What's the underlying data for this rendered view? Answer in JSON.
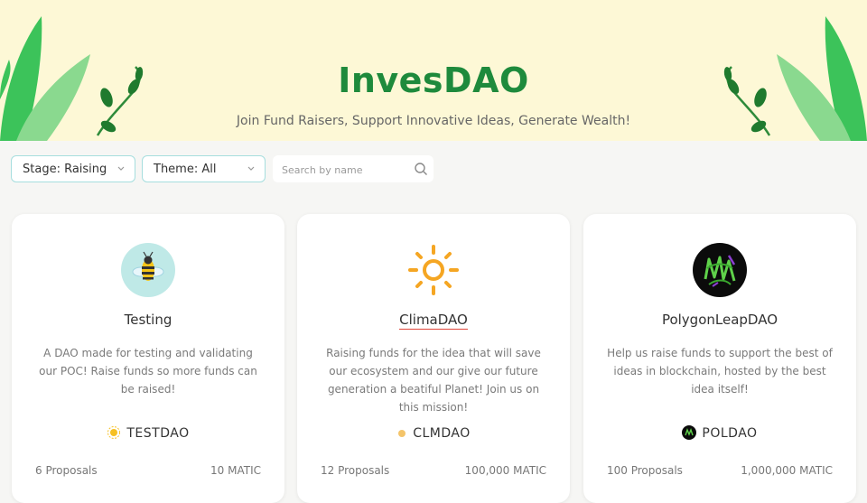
{
  "hero": {
    "title": "InvesDAO",
    "subtitle": "Join Fund Raisers, Support Innovative Ideas, Generate Wealth!",
    "colors": {
      "background": "#fdf8d6",
      "title": "#1e8a3c",
      "leaf": "#3cc35a"
    }
  },
  "filters": {
    "stage_label": "Stage: Raising",
    "theme_label": "Theme: All",
    "search_placeholder": "Search by name",
    "search_value": ""
  },
  "cards": [
    {
      "title": "Testing",
      "description": "A DAO made for testing and validating our POC! Raise funds so more funds can be raised!",
      "token": "TESTDAO",
      "proposals": "6 Proposals",
      "amount": "10 MATIC",
      "avatar_icon": "bee-icon",
      "token_icon": "sun-small-icon"
    },
    {
      "title": "ClimaDAO",
      "description": "Raising funds for the idea that will save our ecosystem and our give our future generation a beatiful Planet! Join us on this mission!",
      "token": "CLMDAO",
      "proposals": "12 Proposals",
      "amount": "100,000 MATIC",
      "avatar_icon": "sun-icon",
      "token_icon": "dot-icon"
    },
    {
      "title": "PolygonLeapDAO",
      "description": "Help us raise funds to support the best of ideas in blockchain, hosted by the best idea itself!",
      "token": "POLDAO",
      "proposals": "100 Proposals",
      "amount": "1,000,000 MATIC",
      "avatar_icon": "polygon-leap-logo-icon",
      "token_icon": "polygon-leap-small-icon"
    }
  ]
}
